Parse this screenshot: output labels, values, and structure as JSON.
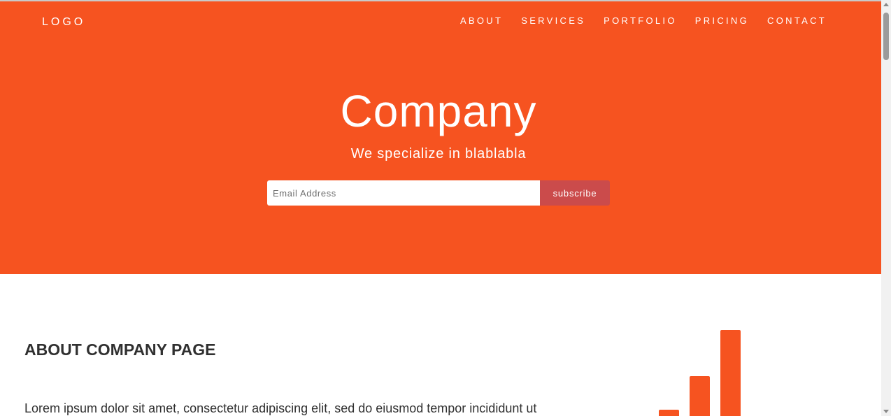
{
  "header": {
    "logo": "LOGO",
    "nav": [
      "ABOUT",
      "SERVICES",
      "PORTFOLIO",
      "PRICING",
      "CONTACT"
    ]
  },
  "hero": {
    "title": "Company",
    "subtitle": "We specialize in blablabla",
    "email_placeholder": "Email Address",
    "email_value": "",
    "subscribe_label": "subscribe"
  },
  "about": {
    "heading": "ABOUT COMPANY PAGE",
    "paragraph": "Lorem ipsum dolor sit amet, consectetur adipiscing elit, sed do eiusmod tempor incididunt ut"
  },
  "icons": {
    "bars_icon": "signal-bars-icon"
  },
  "colors": {
    "brand": "#f65320",
    "button": "#cb4b4b",
    "heading_text": "#303030"
  }
}
